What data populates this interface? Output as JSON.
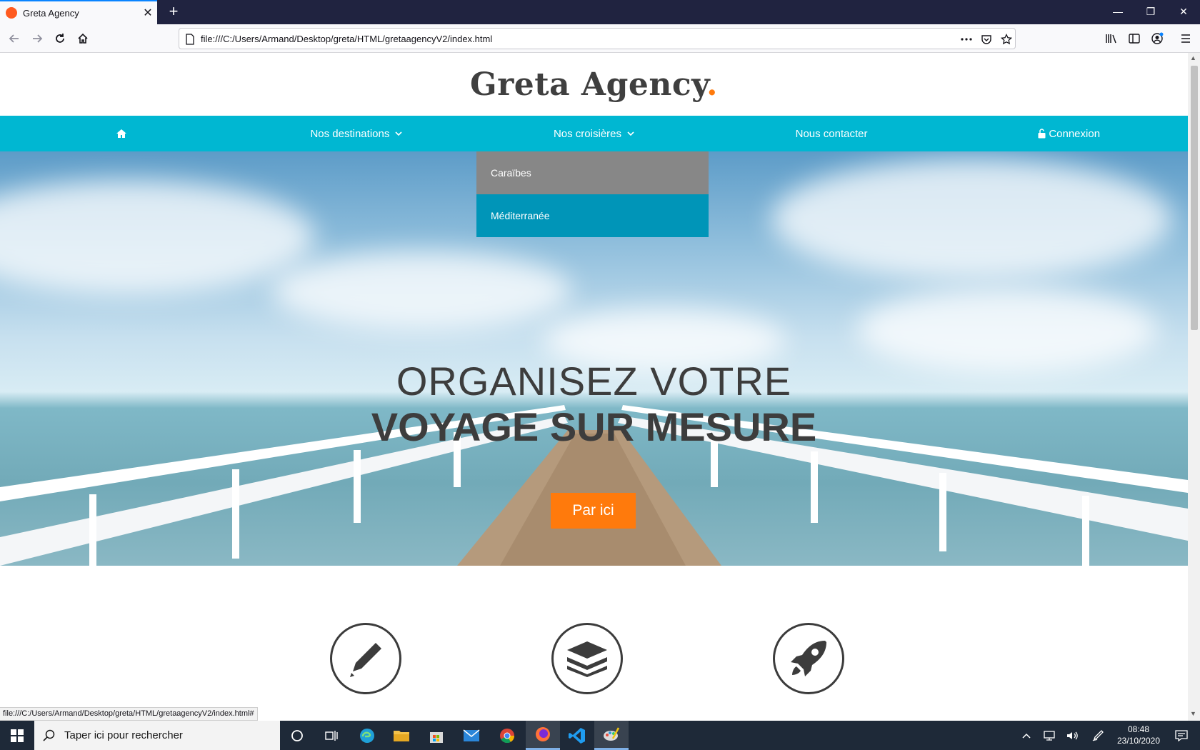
{
  "browser": {
    "tab_title": "Greta Agency",
    "tab_close": "✕",
    "new_tab": "+",
    "url": "file:///C:/Users/Armand/Desktop/greta/HTML/gretaagencyV2/index.html",
    "window_minimize": "—",
    "window_restore": "❐",
    "window_close": "✕",
    "status_url": "file:///C:/Users/Armand/Desktop/greta/HTML/gretaagencyV2/index.html#"
  },
  "site": {
    "logo_text": "Greta Agency",
    "logo_dot": ".",
    "nav": [
      {
        "label": "",
        "icon": "home-icon"
      },
      {
        "label": "Nos destinations",
        "icon": "chevron-down-icon"
      },
      {
        "label": "Nos croisières",
        "icon": "chevron-down-icon"
      },
      {
        "label": "Nous contacter"
      },
      {
        "label": "Connexion",
        "icon": "unlock-icon"
      }
    ],
    "dropdown": [
      "Caraïbes",
      "Méditerranée"
    ],
    "hero_line1": "ORGANISEZ VOTRE",
    "hero_line2": "VOYAGE SUR MESURE",
    "hero_button": "Par ici",
    "features": [
      "pencil-icon",
      "layers-icon",
      "rocket-icon"
    ],
    "colors": {
      "accent": "#00b7d2",
      "orange": "#ff7a0c",
      "dropdown_gray": "#878787",
      "dropdown_blue": "#0095b8"
    }
  },
  "taskbar": {
    "search_placeholder": "Taper ici pour rechercher",
    "time": "08:48",
    "date": "23/10/2020"
  }
}
